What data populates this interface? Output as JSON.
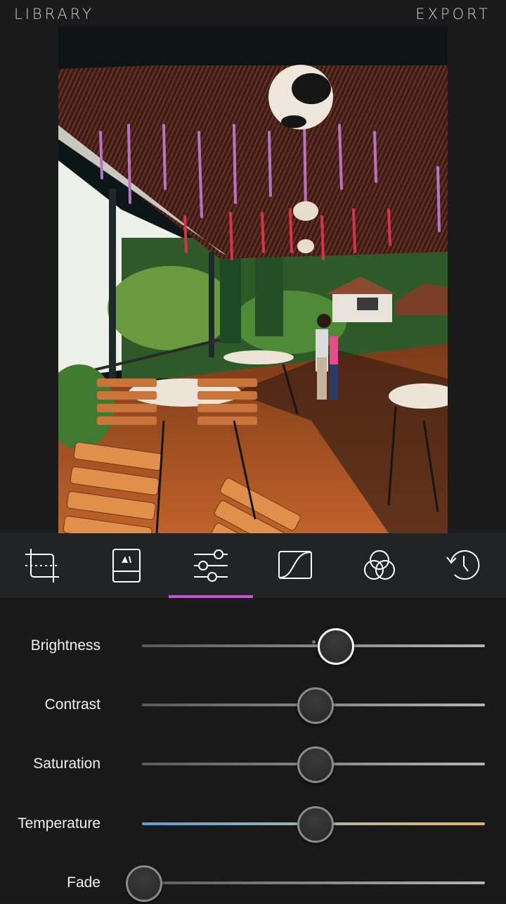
{
  "header": {
    "library_label": "LIBRARY",
    "export_label": "EXPORT"
  },
  "photo": {
    "description": "Outdoor cafe terrace with wooden slatted chairs, round tables, hanging purple and red flowers, cow-pattern lanterns, two girls standing near railing, green trees and houses in background"
  },
  "toolbar": {
    "accent_color": "#c94fd6",
    "active_index": 2,
    "tools": [
      {
        "name": "crop",
        "icon": "crop-icon"
      },
      {
        "name": "frame",
        "icon": "frame-icon"
      },
      {
        "name": "adjust",
        "icon": "sliders-icon"
      },
      {
        "name": "curves",
        "icon": "curves-icon"
      },
      {
        "name": "color-mix",
        "icon": "color-circles-icon"
      },
      {
        "name": "history",
        "icon": "history-icon"
      }
    ]
  },
  "adjustments": [
    {
      "label": "Brightness",
      "value_percent": 56,
      "default_percent": 50,
      "active": true
    },
    {
      "label": "Contrast",
      "value_percent": 50,
      "active": false
    },
    {
      "label": "Saturation",
      "value_percent": 50,
      "active": false
    },
    {
      "label": "Temperature",
      "value_percent": 50,
      "active": false,
      "gradient": [
        "#5b9ed6",
        "#e2b460"
      ]
    },
    {
      "label": "Fade",
      "value_percent": 0,
      "active": false
    }
  ]
}
